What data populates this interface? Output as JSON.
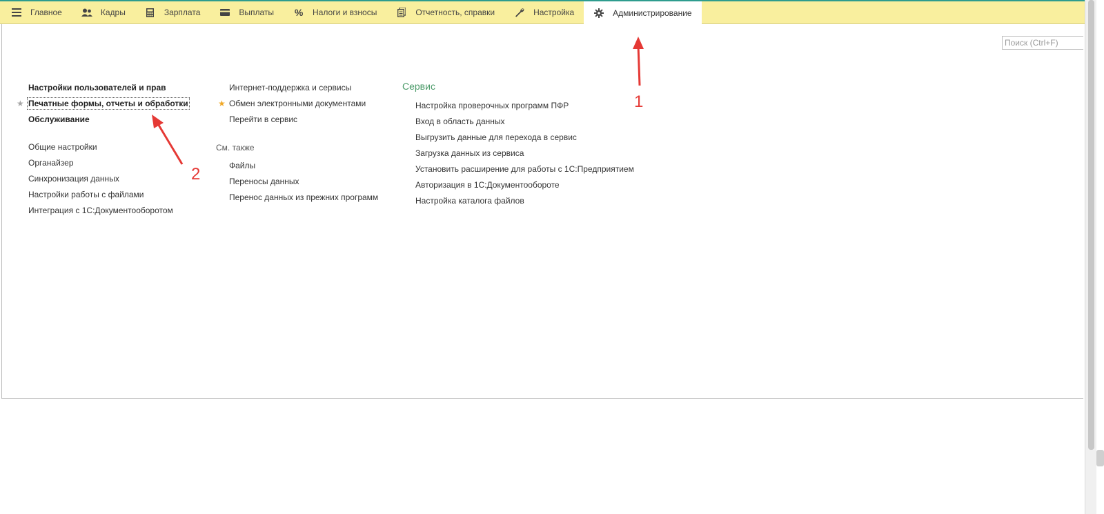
{
  "topbar": {
    "tabs": [
      {
        "label": "Главное",
        "icon": "menu-icon"
      },
      {
        "label": "Кадры",
        "icon": "users-icon"
      },
      {
        "label": "Зарплата",
        "icon": "calculator-icon"
      },
      {
        "label": "Выплаты",
        "icon": "card-icon"
      },
      {
        "label": "Налоги и взносы",
        "icon": "percent-icon"
      },
      {
        "label": "Отчетность, справки",
        "icon": "documents-icon"
      },
      {
        "label": "Настройка",
        "icon": "wrench-icon"
      },
      {
        "label": "Администрирование",
        "icon": "gear-icon",
        "active": true
      }
    ]
  },
  "search": {
    "placeholder": "Поиск (Ctrl+F)"
  },
  "left_column": {
    "main_links": [
      "Настройки пользователей и прав",
      "Печатные формы, отчеты и обработки",
      "Обслуживание"
    ],
    "links": [
      "Общие настройки",
      "Органайзер",
      "Синхронизация данных",
      "Настройки работы с файлами",
      "Интеграция с 1С:Документооборотом"
    ]
  },
  "middle_column": {
    "links": [
      "Интернет-поддержка и сервисы",
      "Обмен электронными документами",
      "Перейти в сервис"
    ],
    "see_also_caption": "См. также",
    "see_also_links": [
      "Файлы",
      "Переносы данных",
      "Перенос данных из прежних программ"
    ]
  },
  "right_column": {
    "title": "Сервис",
    "links": [
      "Настройка проверочных программ ПФР",
      "Вход в область данных",
      "Выгрузить данные для перехода в сервис",
      "Загрузка данных из сервиса",
      "Установить расширение для работы с 1С:Предприятием",
      "Авторизация в 1С:Документообороте",
      "Настройка каталога файлов"
    ]
  },
  "annotations": {
    "label_1": "1",
    "label_2": "2"
  },
  "colors": {
    "topbar_bg": "#f9ef9e",
    "section_title": "#4a9a68",
    "annotation": "#e53935",
    "favorite_star": "#f0a827"
  }
}
